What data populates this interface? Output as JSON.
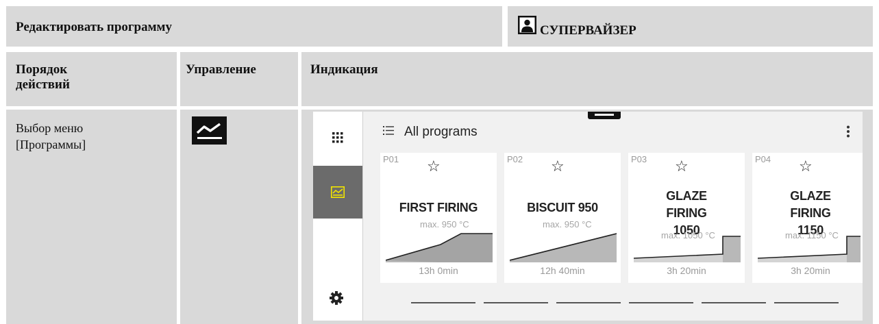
{
  "header": {
    "title": "Редактировать программу",
    "role": "СУПЕРВАЙЗЕР",
    "icon": "user-icon"
  },
  "columns": {
    "steps": "Порядок действий",
    "control": "Управление",
    "display": "Индикация"
  },
  "row": {
    "step": "Выбор меню [Программы]",
    "control_icon": "chart-line-icon"
  },
  "screen": {
    "title": "All programs",
    "list_icon": "list-icon",
    "more_icon": "more-vertical-icon",
    "rail": {
      "items": [
        {
          "icon": "apps-grid-icon",
          "active": false
        },
        {
          "icon": "programs-chart-icon",
          "active": true
        },
        {
          "icon": "settings-gear-icon",
          "active": false
        }
      ]
    },
    "programs": [
      {
        "number": "P01",
        "name": "FIRST FIRING",
        "max": "max. 950 °C",
        "duration": "13h 0min"
      },
      {
        "number": "P02",
        "name": "BISCUIT 950",
        "max": "max. 950 °C",
        "duration": "12h 40min"
      },
      {
        "number": "P03",
        "name": "GLAZE FIRING 1050",
        "max": "max. 1050 °C",
        "duration": "3h 20min"
      },
      {
        "number": "P04",
        "name": "GLAZE FIRING 1150",
        "max": "max. 1150 °C",
        "duration": "3h 20min"
      }
    ],
    "page_count": 6,
    "current_page": 1
  },
  "colors": {
    "cell_bg": "#d9d9d9",
    "accent": "#f2e500",
    "rail_active": "#6b6b6b",
    "screen_bg": "#f1f1f1",
    "curve_fill": "#b8b8b8"
  }
}
